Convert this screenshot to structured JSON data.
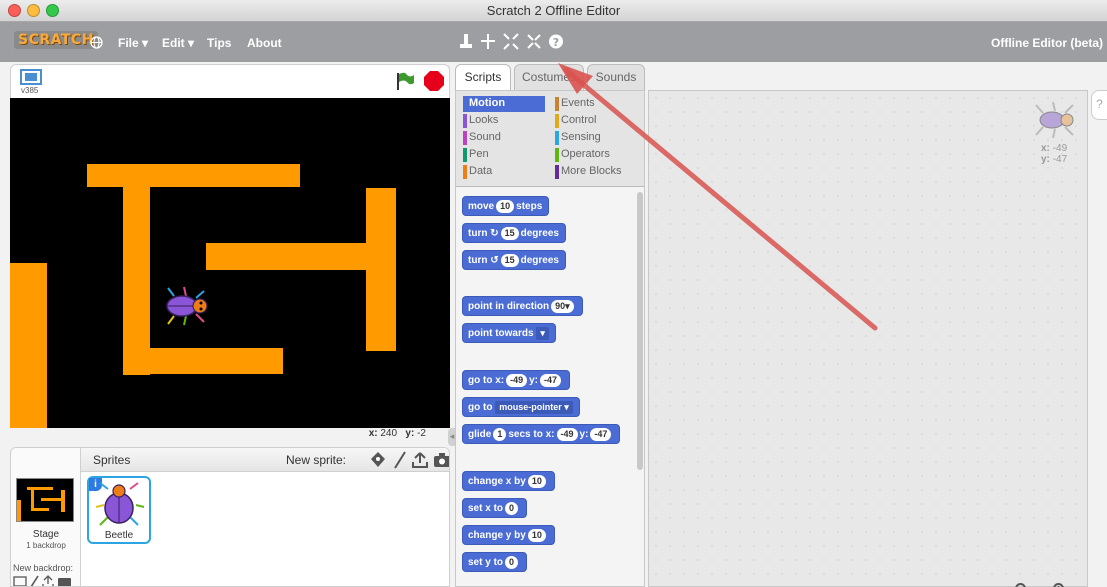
{
  "window": {
    "title": "Scratch 2 Offline Editor"
  },
  "menubar": {
    "logo": "SCRATCH",
    "items": [
      "File ▾",
      "Edit ▾",
      "Tips",
      "About"
    ],
    "right_label": "Offline Editor (beta)",
    "tools": [
      "duplicate-icon",
      "delete-icon",
      "grow-icon",
      "shrink-icon",
      "help-icon"
    ]
  },
  "stage": {
    "version": "v385",
    "mouse_x_label": "x:",
    "mouse_x": "240",
    "mouse_y_label": "y:",
    "mouse_y": "-2"
  },
  "sprites": {
    "header": "Sprites",
    "new_sprite_label": "New sprite:",
    "stage_label": "Stage",
    "stage_backdrops": "1 backdrop",
    "new_backdrop_label": "New backdrop:",
    "items": [
      {
        "name": "Beetle"
      }
    ]
  },
  "tabs": {
    "scripts": "Scripts",
    "costumes": "Costumes",
    "sounds": "Sounds"
  },
  "categories": {
    "left": [
      {
        "label": "Motion",
        "color": "#4a6cd4"
      },
      {
        "label": "Looks",
        "color": "#8a55d7"
      },
      {
        "label": "Sound",
        "color": "#bb42c3"
      },
      {
        "label": "Pen",
        "color": "#0e9a6c"
      },
      {
        "label": "Data",
        "color": "#ee7d16"
      }
    ],
    "right": [
      {
        "label": "Events",
        "color": "#c88330"
      },
      {
        "label": "Control",
        "color": "#e1a91a"
      },
      {
        "label": "Sensing",
        "color": "#2ca5e2"
      },
      {
        "label": "Operators",
        "color": "#5cb712"
      },
      {
        "label": "More Blocks",
        "color": "#632d99"
      }
    ]
  },
  "blocks": {
    "move": {
      "pre": "move",
      "val": "10",
      "post": "steps"
    },
    "turn_right": {
      "pre": "turn",
      "val": "15",
      "post": "degrees"
    },
    "turn_left": {
      "pre": "turn",
      "val": "15",
      "post": "degrees"
    },
    "point_dir": {
      "pre": "point in direction",
      "val": "90▾"
    },
    "point_towards": {
      "pre": "point towards",
      "val": "▾"
    },
    "goto_xy": {
      "pre": "go to x:",
      "x": "-49",
      "mid": "y:",
      "y": "-47"
    },
    "goto": {
      "pre": "go to",
      "val": "mouse-pointer ▾"
    },
    "glide": {
      "pre": "glide",
      "secs": "1",
      "mid1": "secs to x:",
      "x": "-49",
      "mid2": "y:",
      "y": "-47"
    },
    "change_x": {
      "pre": "change x by",
      "val": "10"
    },
    "set_x": {
      "pre": "set x to",
      "val": "0"
    },
    "change_y": {
      "pre": "change y by",
      "val": "10"
    },
    "set_y": {
      "pre": "set y to",
      "val": "0"
    }
  },
  "script_area": {
    "sprite_x_label": "x:",
    "sprite_x": "-49",
    "sprite_y_label": "y:",
    "sprite_y": "-47",
    "help": "?"
  },
  "colors": {
    "maze_wall": "#ff9a00",
    "motion_block": "#4a6cd4",
    "arrow": "#d9534f"
  }
}
